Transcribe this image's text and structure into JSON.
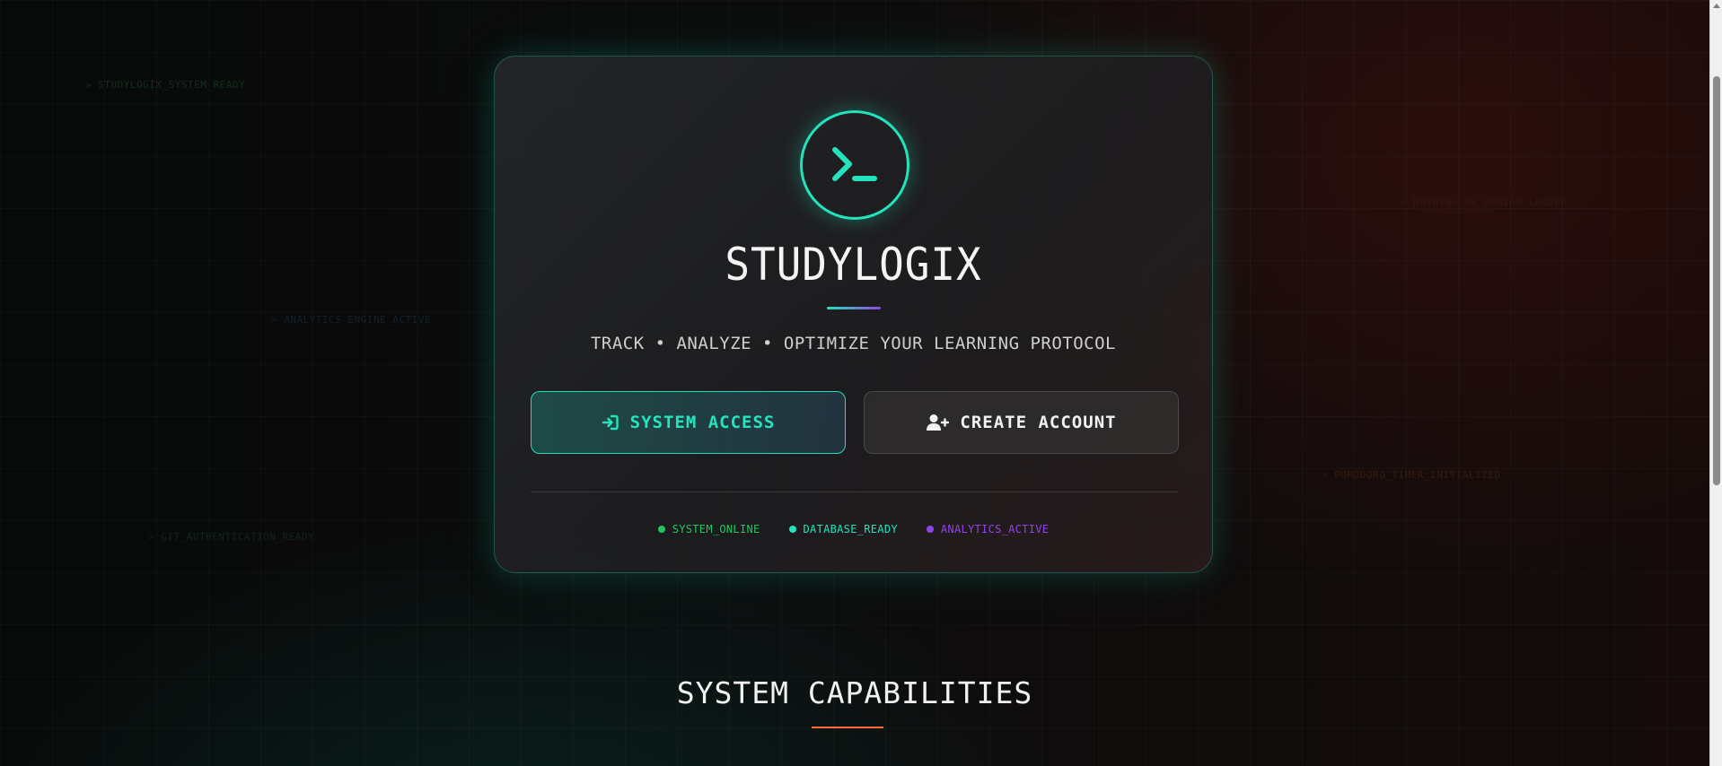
{
  "background_logs": [
    "> STUDYLOGIX_SYSTEM_READY",
    "> NOTHING_OS_DESIGN_LOADED",
    "> ANALYTICS_ENGINE_ACTIVE",
    "> POMODORO_TIMER_INITIALIZED",
    "> GIT_AUTHENTICATION_READY"
  ],
  "hero": {
    "logo_icon": "terminal-prompt-icon",
    "brand": "STUDYLOGIX",
    "tagline": "TRACK • ANALYZE • OPTIMIZE YOUR LEARNING PROTOCOL"
  },
  "actions": {
    "access_icon": "sign-in-icon",
    "access_label": "SYSTEM ACCESS",
    "create_icon": "user-plus-icon",
    "create_label": "CREATE ACCOUNT"
  },
  "status": [
    {
      "label": "SYSTEM_ONLINE",
      "color": "#22c55e"
    },
    {
      "label": "DATABASE_READY",
      "color": "#22e3bc"
    },
    {
      "label": "ANALYTICS_ACTIVE",
      "color": "#8f45e6"
    }
  ],
  "section": {
    "title": "SYSTEM CAPABILITIES"
  },
  "colors": {
    "accent": "#22e3bc",
    "purple": "#8f45e6",
    "orange": "#ff6a3d"
  }
}
